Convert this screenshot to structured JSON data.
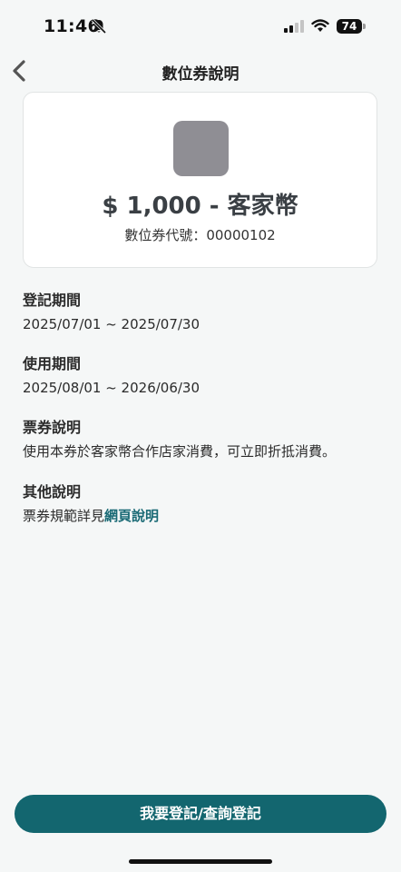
{
  "status_bar": {
    "time": "11:46",
    "battery": "74",
    "icons": [
      "bell-slash-icon",
      "signal-icon",
      "wifi-icon",
      "battery-icon"
    ]
  },
  "nav": {
    "title": "數位券說明",
    "back_icon": "chevron-left-icon"
  },
  "voucher": {
    "amount": "$ 1,000 - 客家幣",
    "code_label": "數位券代號：",
    "code": "00000102"
  },
  "sections": [
    {
      "heading": "登記期間",
      "value": "2025/07/01 ~ 2025/07/30"
    },
    {
      "heading": "使用期間",
      "value": "2025/08/01 ~ 2026/06/30"
    },
    {
      "heading": "票券說明",
      "value": "使用本券於客家幣合作店家消費，可立即折抵消費。"
    },
    {
      "heading": "其他說明",
      "value": "票券規範詳見",
      "link": "網頁說明"
    }
  ],
  "actions": {
    "register_label": "我要登記/查詢登記"
  },
  "colors": {
    "accent": "#13666f",
    "link": "#1a6a75",
    "background": "#f5f7f7"
  }
}
